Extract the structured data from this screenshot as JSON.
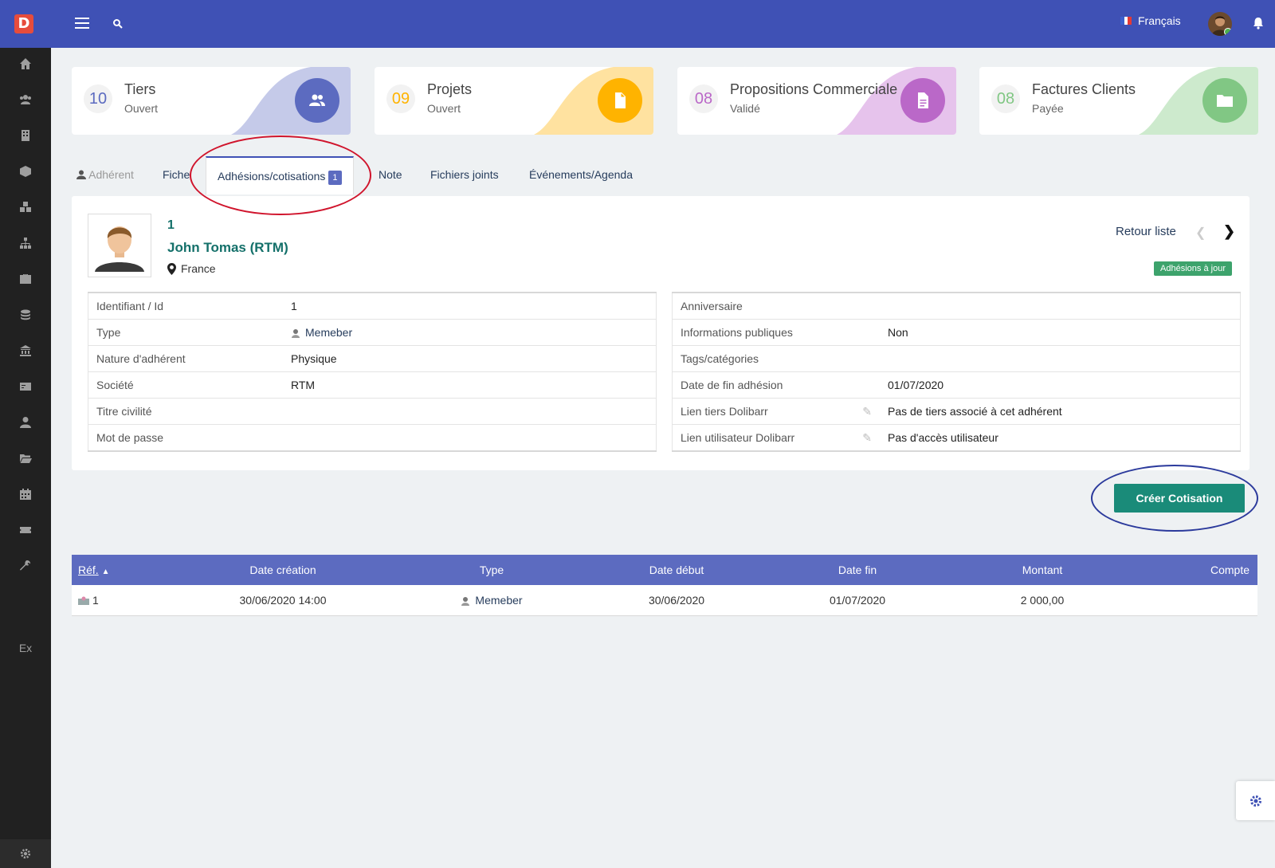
{
  "topbar": {
    "logo_letter": "D",
    "language": "Français",
    "colors": {
      "bar": "#3f51b5",
      "logo": "#e74c3c",
      "online": "#4caf50"
    }
  },
  "sidebar": {
    "icons": [
      "home-icon",
      "users-icon",
      "building-icon",
      "cube-icon",
      "cubes-icon",
      "sitemap-icon",
      "briefcase-icon",
      "coins-icon",
      "bank-icon",
      "invoice-icon",
      "user-tie-icon",
      "folder-open-icon",
      "calendar-icon",
      "ticket-icon",
      "wrench-icon"
    ],
    "ex_label": "Ex",
    "colors": {
      "bg": "#212121"
    }
  },
  "cards": [
    {
      "number": "10",
      "title": "Tiers",
      "status": "Ouvert",
      "color": "#5c6bc0",
      "tint": "#c5cae9",
      "icon": "users-icon"
    },
    {
      "number": "09",
      "title": "Projets",
      "status": "Ouvert",
      "color": "#ffb300",
      "tint": "#ffe2a0",
      "icon": "file-icon"
    },
    {
      "number": "08",
      "title": "Propositions Commerciales",
      "status": "Validé",
      "color": "#ba68c8",
      "tint": "#e6c3ec",
      "icon": "file-text-icon"
    },
    {
      "number": "08",
      "title": "Factures Clients",
      "status": "Payée",
      "color": "#81c784",
      "tint": "#cdeacd",
      "icon": "folder-icon"
    }
  ],
  "tabs": {
    "member_label": "Adhérent",
    "fiche": "Fiche",
    "adhesions": "Adhésions/cotisations",
    "adhesions_count": "1",
    "note": "Note",
    "fichiers": "Fichiers joints",
    "evenements": "Événements/Agenda"
  },
  "member": {
    "id": "1",
    "name": "John Tomas (RTM)",
    "country": "France",
    "back_link": "Retour liste",
    "prev_icon": "chevron-left-icon",
    "next_icon": "chevron-right-icon",
    "status_badge": "Adhésions à jour",
    "status_color": "#3da36c"
  },
  "left_info": [
    {
      "label": "Identifiant / Id",
      "value": "1"
    },
    {
      "label": "Type",
      "value": "Memeber"
    },
    {
      "label": "Nature d'adhérent",
      "value": "Physique"
    },
    {
      "label": "Société",
      "value": "RTM"
    },
    {
      "label": "Titre civilité",
      "value": ""
    },
    {
      "label": "Mot de passe",
      "value": ""
    }
  ],
  "right_info": [
    {
      "label": "Anniversaire",
      "value": ""
    },
    {
      "label": "Informations publiques",
      "value": "Non"
    },
    {
      "label": "Tags/catégories",
      "value": ""
    },
    {
      "label": "Date de fin adhésion",
      "value": "01/07/2020"
    },
    {
      "label": "Lien tiers Dolibarr",
      "value": "Pas de tiers associé à cet adhérent"
    },
    {
      "label": "Lien utilisateur Dolibarr",
      "value": "Pas d'accès utilisateur"
    }
  ],
  "create_button": "Créer Cotisation",
  "subscriptions": {
    "headers": [
      "Réf.",
      "Date création",
      "Type",
      "Date début",
      "Date fin",
      "Montant",
      "Compte"
    ],
    "rows": [
      {
        "ref": "1",
        "created": "30/06/2020 14:00",
        "type": "Memeber",
        "start": "30/06/2020",
        "end": "01/07/2020",
        "amount": "2 000,00",
        "account": ""
      }
    ],
    "header_color": "#5c6bc0"
  }
}
